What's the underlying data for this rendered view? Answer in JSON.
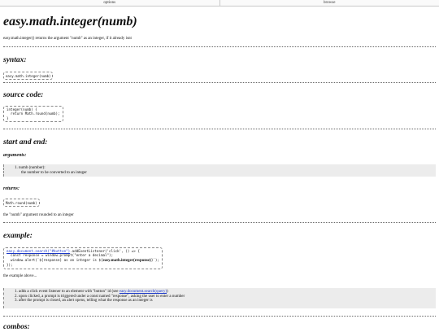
{
  "topbar": {
    "options": "options",
    "browse": "browse"
  },
  "title": "easy.math.integer(numb)",
  "intro": "easy.math.integer() returns the argument \"numb\" as an integer, if it already isnt",
  "syntax": {
    "heading": "syntax:",
    "code": "easy.math.integer(numb)"
  },
  "source": {
    "heading": "source code:",
    "lines": [
      "integer(numb) {",
      "  return Math.round(numb);",
      "}"
    ]
  },
  "start_end": {
    "heading": "start and end:",
    "arguments_heading": "arguments:",
    "arg_name": "numb (number):",
    "arg_desc": "the number to be converted to an integer",
    "returns_heading": "returns:",
    "returns_code": "Math.round(numb)",
    "returns_desc": "the \"numb\" argument rounded to an integer"
  },
  "example": {
    "heading": "example:",
    "line1_link": "easy.document.search(\"#button\")",
    "line1_rest": ".addEventListener('click', () => {",
    "line2": "  const response = window.prompt(\"enter a decimal\");",
    "line3_pre": "  window.alert(`${response} as an integer is ${",
    "line3_bold": "easy.math.integer(response)",
    "line3_post": "}`);",
    "line4": "});",
    "above": "the example above...",
    "steps": [
      {
        "pre": "adds a click event listener to an element with \"button\" id (see ",
        "link": "easy.document.search(query)",
        "post": ")"
      },
      {
        "pre": "upon clicked, a prompt is triggered under a const named \"response\", asking the user to enter a number",
        "link": "",
        "post": ""
      },
      {
        "pre": "after the prompt is closed, an alert opens, telling what the response as an integer is",
        "link": "",
        "post": ""
      }
    ]
  },
  "combos": {
    "heading": "combos:"
  }
}
